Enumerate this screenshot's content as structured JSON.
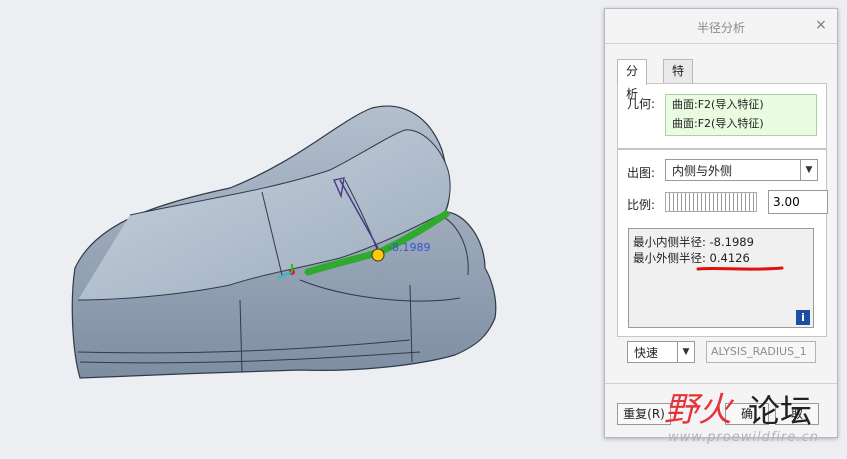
{
  "dialog": {
    "title": "半径分析",
    "close_glyph": "×",
    "tabs": [
      {
        "label": "分析",
        "active": true
      },
      {
        "label": "特征",
        "active": false
      }
    ],
    "geometry": {
      "label": "几何:",
      "items": [
        "曲面:F2(导入特征)",
        "曲面:F2(导入特征)"
      ]
    },
    "output": {
      "label": "出图:",
      "value": "内侧与外侧"
    },
    "scale": {
      "label": "比例:",
      "value": "3.00"
    },
    "results": {
      "min_inner": "最小内侧半径: -8.1989",
      "min_outer": "最小外侧半径: 0.4126"
    },
    "info_glyph": "i",
    "mode": {
      "value": "快速"
    },
    "feature_name": "ALYSIS_RADIUS_1",
    "buttons": {
      "repeat": "重复(R)",
      "confirm": "确",
      "cancel": "取"
    }
  },
  "viewport": {
    "annotation": "-8.1989"
  },
  "watermark": {
    "logo_a": "野火",
    "logo_b": "论坛",
    "site": "www.proewildfire.cn"
  },
  "colors": {
    "model": "#9aa9bb",
    "highlight": "#2faa2f",
    "underline": "#e01010",
    "geo_bg": "#e9fbe0"
  }
}
